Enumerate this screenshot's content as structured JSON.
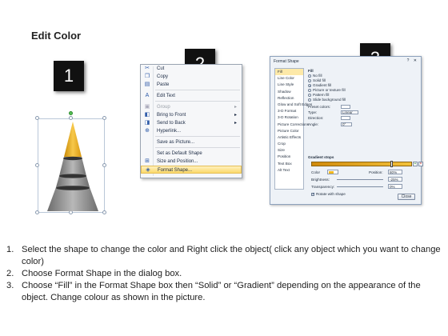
{
  "title": "Edit Color",
  "badges": [
    "1",
    "2",
    "3"
  ],
  "context_menu": {
    "items": [
      {
        "label": "Cut",
        "icon": "scissors-icon",
        "glyph": "✂",
        "disabled": false,
        "arrow": false
      },
      {
        "label": "Copy",
        "icon": "copy-icon",
        "glyph": "❐",
        "disabled": false,
        "arrow": false
      },
      {
        "label": "Paste",
        "icon": "paste-icon",
        "glyph": "▤",
        "disabled": false,
        "arrow": false
      },
      {
        "sep": true
      },
      {
        "label": "Edit Text",
        "icon": "edit-text-icon",
        "glyph": "A",
        "disabled": false,
        "arrow": false
      },
      {
        "sep": true
      },
      {
        "label": "Group",
        "icon": "group-icon",
        "glyph": "▣",
        "disabled": true,
        "arrow": true
      },
      {
        "label": "Bring to Front",
        "icon": "bring-front-icon",
        "glyph": "◧",
        "disabled": false,
        "arrow": true
      },
      {
        "label": "Send to Back",
        "icon": "send-back-icon",
        "glyph": "◨",
        "disabled": false,
        "arrow": true
      },
      {
        "label": "Hyperlink...",
        "icon": "hyperlink-icon",
        "glyph": "⊕",
        "disabled": false,
        "arrow": false
      },
      {
        "sep": true
      },
      {
        "label": "Save as Picture...",
        "icon": "",
        "glyph": "",
        "disabled": false,
        "arrow": false
      },
      {
        "sep": true
      },
      {
        "label": "Set as Default Shape",
        "icon": "",
        "glyph": "",
        "disabled": false,
        "arrow": false
      },
      {
        "label": "Size and Position...",
        "icon": "size-position-icon",
        "glyph": "⊞",
        "disabled": false,
        "arrow": false
      },
      {
        "label": "Format Shape...",
        "icon": "format-shape-icon",
        "glyph": "◈",
        "disabled": false,
        "arrow": false,
        "highlighted": true
      }
    ]
  },
  "dialog": {
    "title": "Format Shape",
    "controls": "? ✕",
    "categories": [
      "Fill",
      "Line Color",
      "Line Style",
      "Shadow",
      "Reflection",
      "Glow and Soft Edges",
      "3-D Format",
      "3-D Rotation",
      "Picture Corrections",
      "Picture Color",
      "Artistic Effects",
      "Crop",
      "Size",
      "Position",
      "Text Box",
      "Alt Text"
    ],
    "selected_category": 0,
    "fill_heading": "Fill",
    "fill_options": [
      {
        "label": "No fill",
        "on": false
      },
      {
        "label": "Solid fill",
        "on": false
      },
      {
        "label": "Gradient fill",
        "on": true
      },
      {
        "label": "Picture or texture fill",
        "on": false
      },
      {
        "label": "Pattern fill",
        "on": false
      },
      {
        "label": "Slide background fill",
        "on": false
      }
    ],
    "props": [
      {
        "label": "Preset colors:",
        "value": ""
      },
      {
        "label": "Type:",
        "value": "Linear"
      },
      {
        "label": "Direction:",
        "value": ""
      },
      {
        "label": "Angle:",
        "value": "0°"
      }
    ],
    "gradient_heading": "Gradient stops",
    "color_label": "Color",
    "position_label": "Position:",
    "position_value": "80%",
    "brightness_label": "Brightness:",
    "brightness_value": "-25%",
    "transparency_label": "Transparency:",
    "transparency_value": "0%",
    "rotate_label": "Rotate with shape",
    "close_label": "Close"
  },
  "steps": [
    {
      "num": "1.",
      "text": "Select the shape to change the color and Right click the object( click any object which you want to change color)"
    },
    {
      "num": "2.",
      "text": "Choose Format Shape in the dialog box."
    },
    {
      "num": "3.",
      "text": "Choose “Fill” in the Format Shape box then “Solid” or “Gradient” depending on the appearance of the object. Change colour as shown in the picture."
    }
  ],
  "colors": {
    "cone_tip": "#f2b91f",
    "cone_body": "#8a8a8a",
    "highlight": "#fbd96b"
  }
}
